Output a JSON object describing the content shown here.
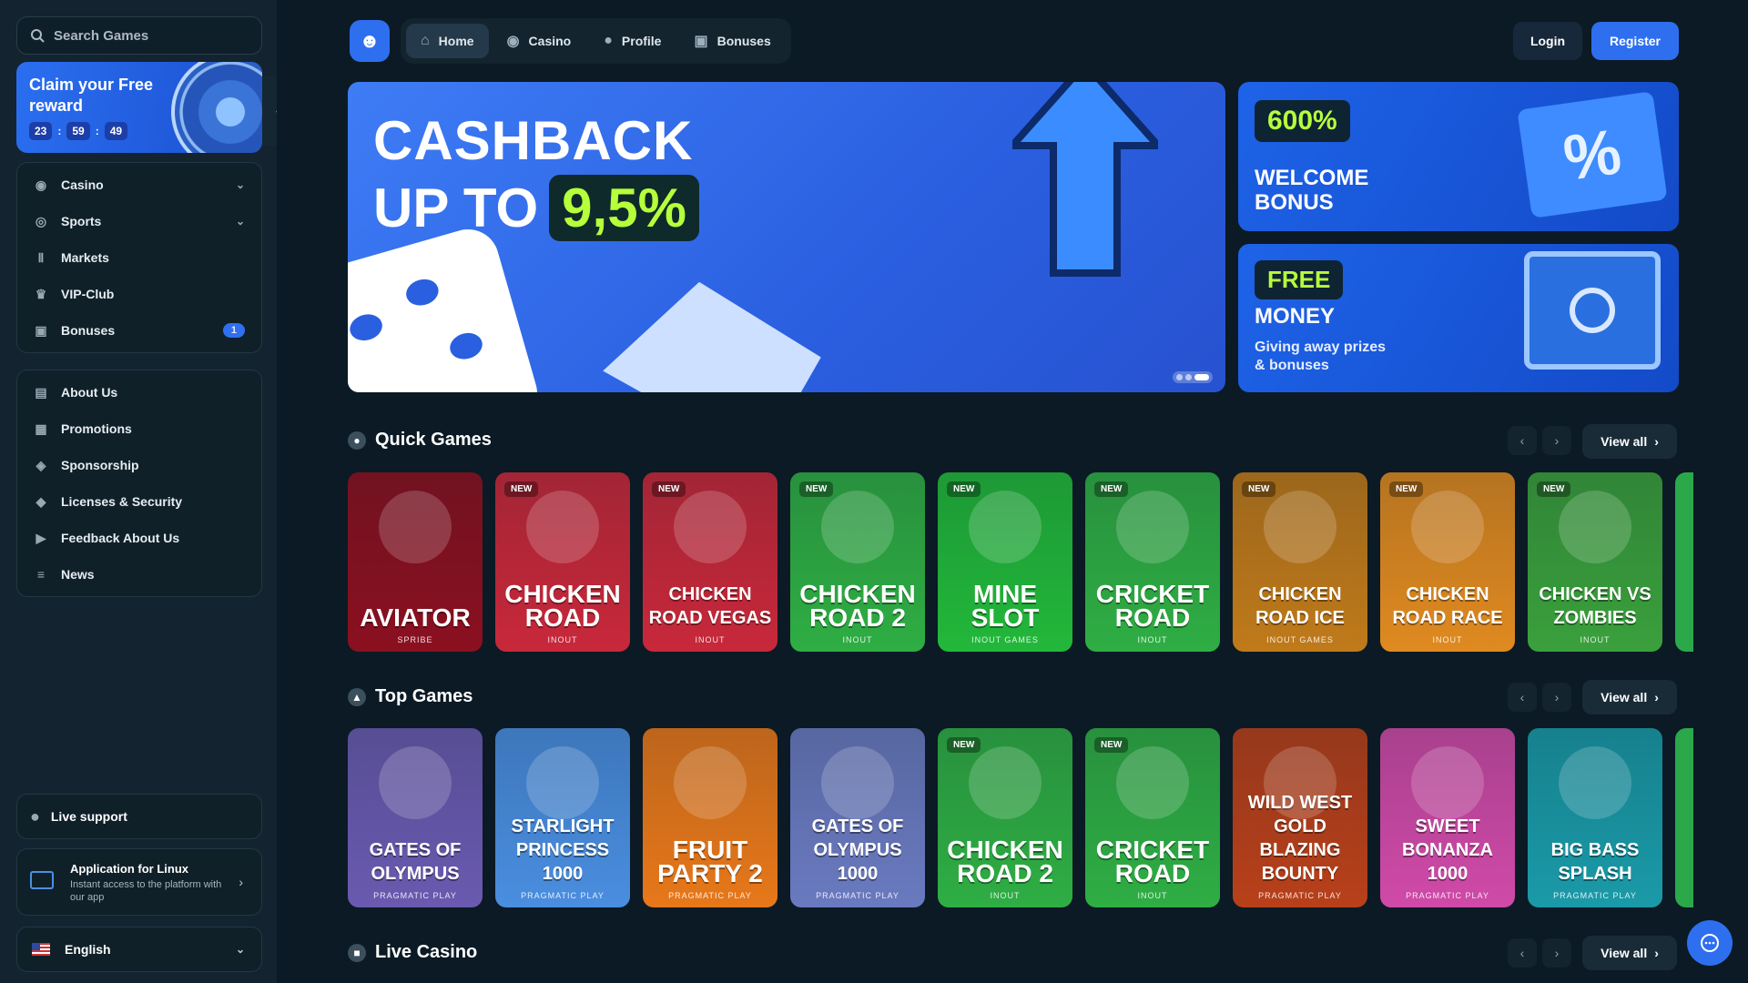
{
  "sidebar": {
    "search_placeholder": "Search Games",
    "reward": {
      "title": "Claim your Free reward",
      "hours": "23",
      "minutes": "59",
      "seconds": "49"
    },
    "menu1": [
      {
        "label": "Casino",
        "icon": "casino-chip-icon",
        "expandable": true
      },
      {
        "label": "Sports",
        "icon": "ball-icon",
        "expandable": true
      },
      {
        "label": "Markets",
        "icon": "chart-bars-icon"
      },
      {
        "label": "VIP-Club",
        "icon": "crown-icon"
      },
      {
        "label": "Bonuses",
        "icon": "gift-icon",
        "badge": "1"
      }
    ],
    "menu2": [
      {
        "label": "About Us",
        "icon": "book-icon"
      },
      {
        "label": "Promotions",
        "icon": "tickets-icon"
      },
      {
        "label": "Sponsorship",
        "icon": "medal-icon"
      },
      {
        "label": "Licenses & Security",
        "icon": "shield-icon"
      },
      {
        "label": "Feedback About Us",
        "icon": "megaphone-icon"
      },
      {
        "label": "News",
        "icon": "newspaper-icon"
      }
    ],
    "live_support": "Live support",
    "app": {
      "title": "Application for Linux",
      "subtitle": "Instant access to the platform with our app"
    },
    "language": "English"
  },
  "header": {
    "tabs": [
      {
        "label": "Home",
        "icon": "home-icon",
        "active": true
      },
      {
        "label": "Casino",
        "icon": "casino-chip-icon"
      },
      {
        "label": "Profile",
        "icon": "user-icon"
      },
      {
        "label": "Bonuses",
        "icon": "gift-icon"
      }
    ],
    "login": "Login",
    "register": "Register"
  },
  "hero": {
    "line1": "CASHBACK",
    "line2": "UP TO",
    "percent": "9,5%",
    "slides": 3,
    "active_slide": 3
  },
  "promos": [
    {
      "badge": "600%",
      "title": "WELCOME BONUS"
    },
    {
      "badge": "FREE",
      "title": "MONEY",
      "subtitle": "Giving away prizes & bonuses"
    }
  ],
  "sections": {
    "quick": {
      "title": "Quick Games",
      "view_all": "View all"
    },
    "top": {
      "title": "Top Games",
      "view_all": "View all"
    },
    "live": {
      "title": "Live Casino",
      "view_all": "View all"
    }
  },
  "quick_games": [
    {
      "name": "AVIATOR",
      "provider": "SPRIBE",
      "new": false,
      "color": "#8b1020"
    },
    {
      "name": "CHICKEN ROAD",
      "provider": "INOUT",
      "new": true,
      "color": "#c8283a"
    },
    {
      "name": "CHICKEN ROAD VEGAS",
      "provider": "INOUT",
      "new": true,
      "color": "#c8283a"
    },
    {
      "name": "CHICKEN ROAD 2",
      "provider": "INOUT",
      "new": true,
      "color": "#2fae44"
    },
    {
      "name": "MINE SLOT",
      "provider": "INOUT GAMES",
      "new": true,
      "color": "#22b83a"
    },
    {
      "name": "CRICKET ROAD",
      "provider": "INOUT",
      "new": true,
      "color": "#2fae44"
    },
    {
      "name": "CHICKEN ROAD ICE",
      "provider": "INOUT GAMES",
      "new": true,
      "color": "#c07a1a"
    },
    {
      "name": "CHICKEN ROAD RACE",
      "provider": "INOUT",
      "new": true,
      "color": "#e08a20"
    },
    {
      "name": "CHICKEN VS ZOMBIES",
      "provider": "INOUT",
      "new": true,
      "color": "#3aa03c"
    }
  ],
  "top_games": [
    {
      "name": "GATES OF OLYMPUS",
      "provider": "PRAGMATIC PLAY",
      "new": false,
      "color": "#6a5ab0"
    },
    {
      "name": "STARLIGHT PRINCESS 1000",
      "provider": "PRAGMATIC PLAY",
      "new": false,
      "color": "#4a8ee0"
    },
    {
      "name": "FRUIT PARTY 2",
      "provider": "PRAGMATIC PLAY",
      "new": false,
      "color": "#e8781a"
    },
    {
      "name": "GATES OF OLYMPUS 1000",
      "provider": "PRAGMATIC PLAY",
      "new": false,
      "color": "#6a7ac0"
    },
    {
      "name": "CHICKEN ROAD 2",
      "provider": "INOUT",
      "new": true,
      "color": "#2fae44"
    },
    {
      "name": "CRICKET ROAD",
      "provider": "INOUT",
      "new": true,
      "color": "#2fae44"
    },
    {
      "name": "WILD WEST GOLD BLAZING BOUNTY",
      "provider": "PRAGMATIC PLAY",
      "new": false,
      "color": "#b8401a"
    },
    {
      "name": "SWEET BONANZA 1000",
      "provider": "PRAGMATIC PLAY",
      "new": false,
      "color": "#d04aa8"
    },
    {
      "name": "BIG BASS SPLASH",
      "provider": "PRAGMATIC PLAY",
      "new": false,
      "color": "#1a9aa8"
    }
  ],
  "new_label": "NEW"
}
